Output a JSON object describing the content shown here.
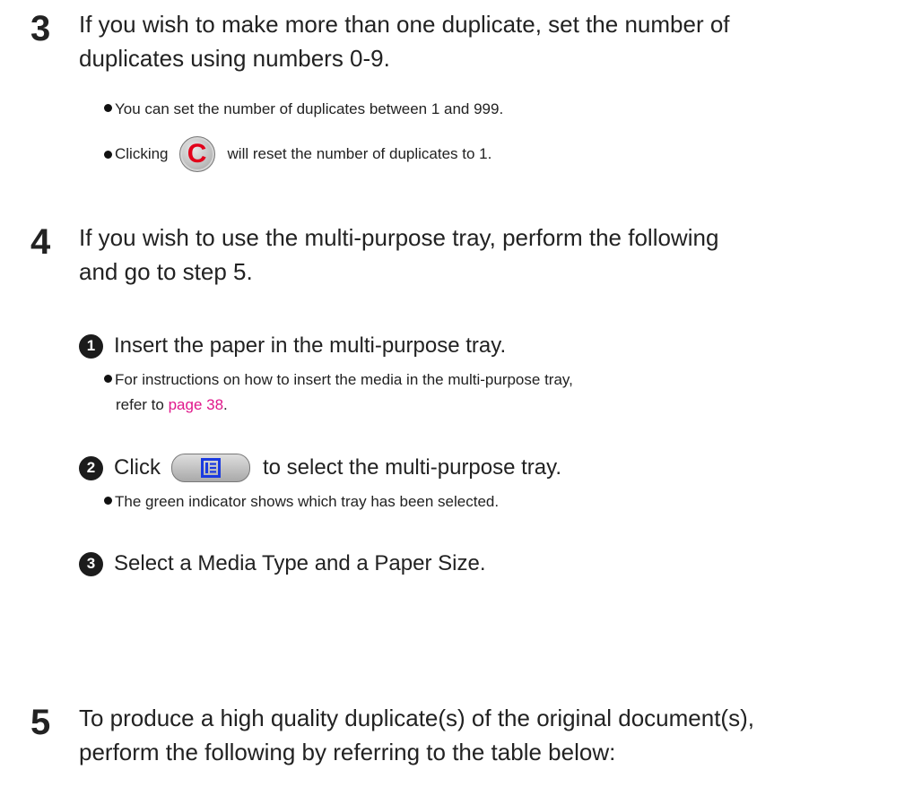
{
  "steps": [
    {
      "number": "3",
      "text_line1": "If you wish to make more than one duplicate, set the number of",
      "text_line2": "duplicates using numbers 0-9.",
      "bullets": [
        "You can set the number of duplicates between 1 and 999.",
        {
          "before": "Clicking",
          "icon": "clear-c-icon",
          "after": "will reset the number of duplicates to 1."
        }
      ]
    },
    {
      "number": "4",
      "text_line1": "If you wish to use the multi-purpose tray, perform the following",
      "text_line2": "and go to step 5.",
      "substeps": [
        {
          "marker": "1",
          "text": "Insert the paper in the multi-purpose tray.",
          "bullet_line1": "For instructions on how to insert the media in the multi-purpose tray,",
          "bullet_line2_before": "refer to ",
          "bullet_link": "page 38",
          "bullet_line2_after": "."
        },
        {
          "marker": "2",
          "before": "Click",
          "icon": "multi-purpose-tray-icon",
          "after": "to select the multi-purpose tray.",
          "bullet": "The green indicator shows which tray has been selected."
        },
        {
          "marker": "3",
          "text": "Select a Media Type and a Paper Size."
        }
      ]
    },
    {
      "number": "5",
      "text_line1": "To produce a high quality duplicate(s) of the original document(s),",
      "text_line2": "perform the following by referring to the table below:"
    }
  ],
  "colors": {
    "text": "#222222",
    "link": "#e0178b",
    "clear_icon_letter": "#e2001a",
    "tray_icon": "#1a3ae0"
  }
}
